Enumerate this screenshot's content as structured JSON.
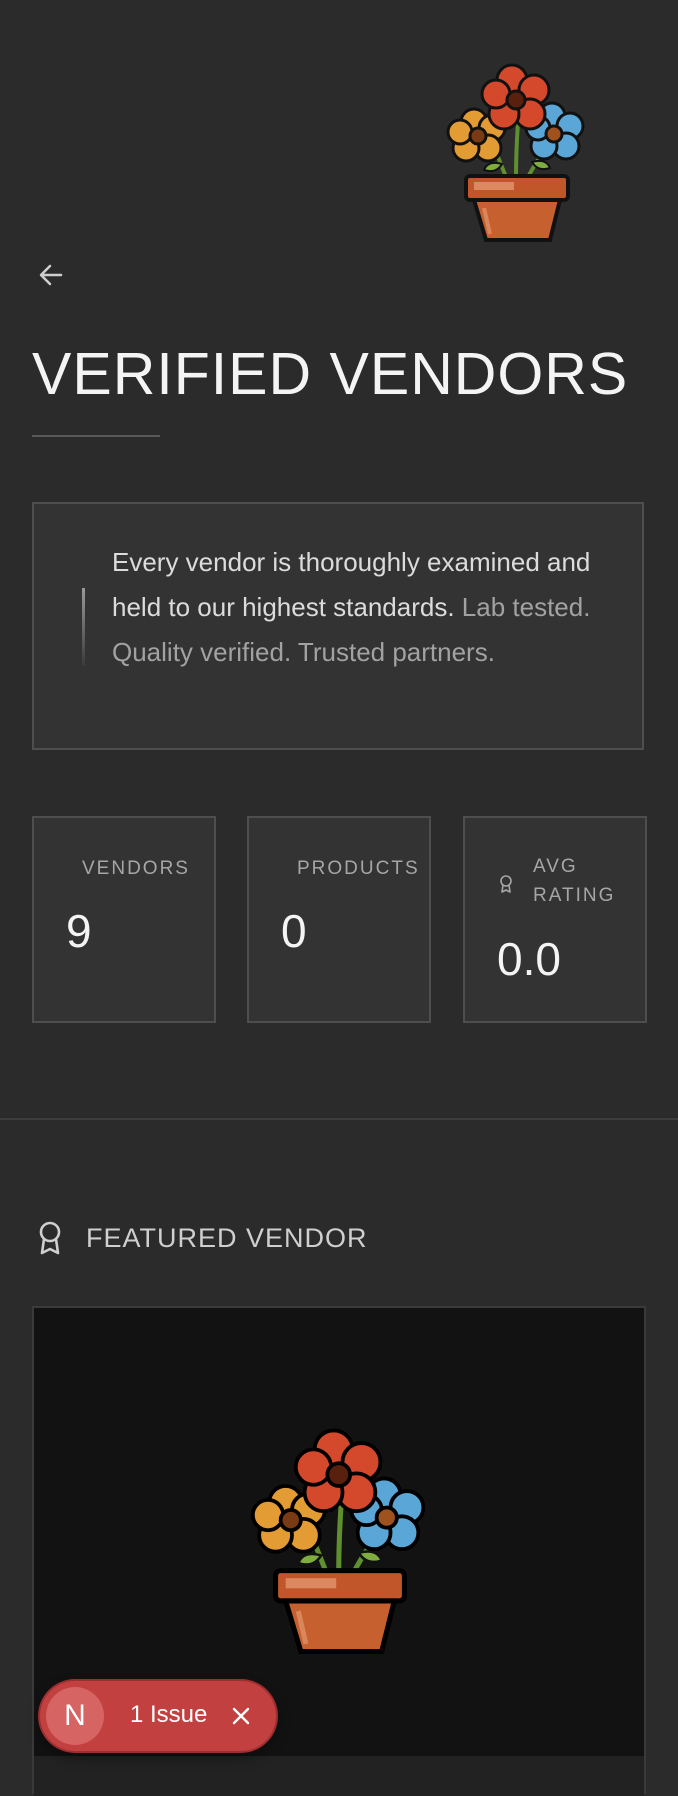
{
  "header": {
    "logo_icon": "flower-pot-logo",
    "back_icon": "arrow-left-icon",
    "title": "VERIFIED VENDORS"
  },
  "intro": {
    "line_strong": "Every vendor is thoroughly examined and held to our highest standards.",
    "line_sub": "Lab tested. Quality verified. Trusted partners."
  },
  "stats": [
    {
      "label": "VENDORS",
      "value": "9"
    },
    {
      "label": "PRODUCTS",
      "value": "0"
    },
    {
      "label": "AVG RATING",
      "value": "0.0",
      "icon": "award-icon"
    }
  ],
  "featured": {
    "icon": "award-icon",
    "label": "FEATURED VENDOR",
    "image_icon": "flower-pot-logo"
  },
  "issue_badge": {
    "avatar_letter": "N",
    "text": "1 Issue",
    "close_icon": "close-icon"
  },
  "colors": {
    "background": "#2b2b2b",
    "card": "#333333",
    "border": "#4e4e4e",
    "issue_red": "#c2403f"
  }
}
